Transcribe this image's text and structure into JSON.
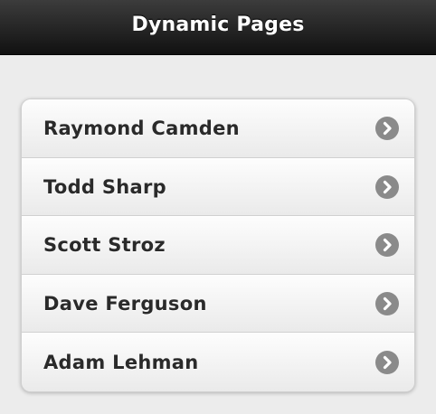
{
  "header": {
    "title": "Dynamic Pages"
  },
  "list": {
    "items": [
      {
        "label": "Raymond Camden"
      },
      {
        "label": "Todd Sharp"
      },
      {
        "label": "Scott Stroz"
      },
      {
        "label": "Dave Ferguson"
      },
      {
        "label": "Adam Lehman"
      }
    ],
    "icon": "chevron-right-icon",
    "icon_color": "#8a8a8a"
  }
}
